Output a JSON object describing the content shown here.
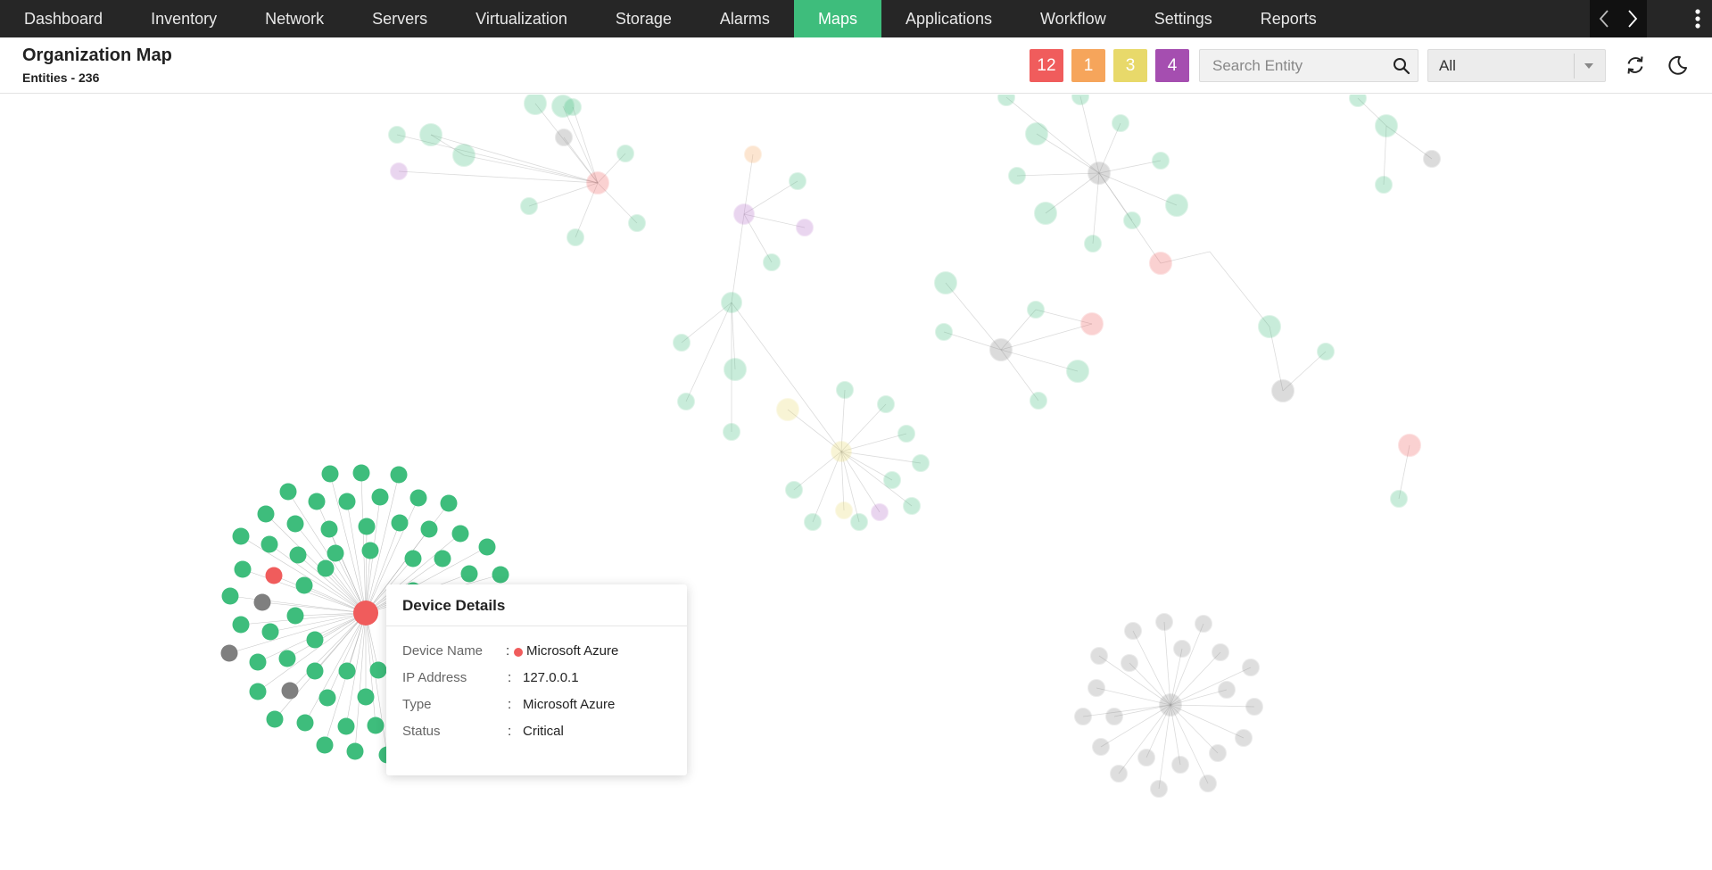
{
  "nav": {
    "items": [
      {
        "label": "Dashboard",
        "name": "nav-dashboard"
      },
      {
        "label": "Inventory",
        "name": "nav-inventory"
      },
      {
        "label": "Network",
        "name": "nav-network"
      },
      {
        "label": "Servers",
        "name": "nav-servers"
      },
      {
        "label": "Virtualization",
        "name": "nav-virtualization"
      },
      {
        "label": "Storage",
        "name": "nav-storage"
      },
      {
        "label": "Alarms",
        "name": "nav-alarms"
      },
      {
        "label": "Maps",
        "name": "nav-maps",
        "active": true
      },
      {
        "label": "Applications",
        "name": "nav-applications"
      },
      {
        "label": "Workflow",
        "name": "nav-workflow"
      },
      {
        "label": "Settings",
        "name": "nav-settings"
      },
      {
        "label": "Reports",
        "name": "nav-reports"
      }
    ],
    "active_color": "#3ebd7c",
    "icons": {
      "prev": "chevron-left-icon",
      "next": "chevron-right-icon",
      "more": "kebab-menu-icon"
    }
  },
  "header": {
    "title": "Organization Map",
    "entity_count": "Entities - 236",
    "badges": [
      {
        "value": "12",
        "color": "#f05c5c",
        "severity": "critical"
      },
      {
        "value": "1",
        "color": "#f6a55b",
        "severity": "major"
      },
      {
        "value": "3",
        "color": "#e8d96a",
        "severity": "minor"
      },
      {
        "value": "4",
        "color": "#a54eb0",
        "severity": "warning"
      }
    ],
    "search": {
      "placeholder": "Search Entity",
      "value": "",
      "icon": "search-icon"
    },
    "filter": {
      "selected": "All",
      "icon": "caret-down-icon"
    },
    "actions": {
      "refresh_icon": "refresh-icon",
      "theme_icon": "moon-icon"
    }
  },
  "map": {
    "status_colors": {
      "clear": "#3ebd7c",
      "critical": "#f05c5c",
      "unknown": "#7f7f7f",
      "minor": "#e8d96a",
      "major": "#f6a55b",
      "warning": "#b46ac8"
    }
  },
  "tooltip": {
    "title": "Device Details",
    "rows": [
      {
        "label": "Device Name",
        "value": "Microsoft Azure",
        "status_dot": true
      },
      {
        "label": "IP Address",
        "value": "127.0.0.1"
      },
      {
        "label": "Type",
        "value": "Microsoft Azure"
      },
      {
        "label": "Status",
        "value": "Critical"
      }
    ]
  }
}
